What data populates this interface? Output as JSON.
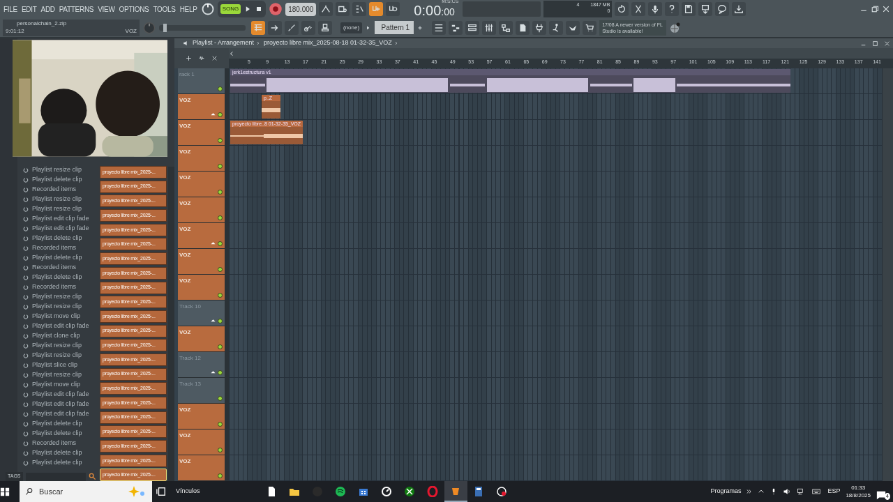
{
  "menu": [
    "FILE",
    "EDIT",
    "ADD",
    "PATTERNS",
    "VIEW",
    "OPTIONS",
    "TOOLS",
    "HELP"
  ],
  "transport": {
    "song_label": "SONG",
    "song_on": true,
    "tempo": "180.000"
  },
  "snap_tools": [
    {
      "on": false
    },
    {
      "on": false
    },
    {
      "on": false
    },
    {
      "on": true
    },
    {
      "on": false
    }
  ],
  "time": {
    "main": "0:00",
    "fraction": ":00",
    "label": "M:S:CS"
  },
  "monitor": {
    "cpu": "4",
    "memory": "1847 MB",
    "voices": "0"
  },
  "hint": {
    "title": "personalchain_2.zip",
    "value": "9:01:12",
    "channel": "VOZ"
  },
  "master_pitch": {
    "level": 0.05
  },
  "view_tools": [
    {
      "on": true
    },
    {
      "on": false
    },
    {
      "on": false
    },
    {
      "on": false
    },
    {
      "on": false
    }
  ],
  "pattern": {
    "none": "(none)",
    "name": "Pattern 1"
  },
  "news": {
    "date": "17/08",
    "text": "A newer version of FL Studio is available!"
  },
  "history": [
    {
      "label": "Playlist resize clip"
    },
    {
      "label": "Playlist delete clip"
    },
    {
      "label": "Recorded items"
    },
    {
      "label": "Playlist resize clip"
    },
    {
      "label": "Playlist resize clip"
    },
    {
      "label": "Playlist edit clip fade"
    },
    {
      "label": "Playlist edit clip fade"
    },
    {
      "label": "Playlist delete clip"
    },
    {
      "label": "Recorded items"
    },
    {
      "label": "Playlist delete clip"
    },
    {
      "label": "Recorded items"
    },
    {
      "label": "Playlist delete clip"
    },
    {
      "label": "Recorded items"
    },
    {
      "label": "Playlist resize clip"
    },
    {
      "label": "Playlist resize clip"
    },
    {
      "label": "Playlist move clip"
    },
    {
      "label": "Playlist edit clip fade"
    },
    {
      "label": "Playlist clone clip"
    },
    {
      "label": "Playlist resize clip"
    },
    {
      "label": "Playlist resize clip"
    },
    {
      "label": "Playlist slice clip"
    },
    {
      "label": "Playlist resize clip"
    },
    {
      "label": "Playlist move clip"
    },
    {
      "label": "Playlist edit clip fade"
    },
    {
      "label": "Playlist edit clip fade"
    },
    {
      "label": "Playlist edit clip fade"
    },
    {
      "label": "Playlist delete clip"
    },
    {
      "label": "Playlist delete clip"
    },
    {
      "label": "Recorded items"
    },
    {
      "label": "Playlist delete clip"
    },
    {
      "label": "Playlist delete clip"
    }
  ],
  "clips_list": [
    {
      "label": "proyecto libre mix_2025-...",
      "selected": false
    },
    {
      "label": "proyecto libre mix_2025-...",
      "selected": false
    },
    {
      "label": "proyecto libre mix_2025-...",
      "selected": false
    },
    {
      "label": "proyecto libre mix_2025-...",
      "selected": false
    },
    {
      "label": "proyecto libre mix_2025-...",
      "selected": false
    },
    {
      "label": "proyecto libre mix_2025-...",
      "selected": false
    },
    {
      "label": "proyecto libre mix_2025-...",
      "selected": false
    },
    {
      "label": "proyecto libre mix_2025-...",
      "selected": false
    },
    {
      "label": "proyecto libre mix_2025-...",
      "selected": false
    },
    {
      "label": "proyecto libre mix_2025-...",
      "selected": false
    },
    {
      "label": "proyecto libre mix_2025-...",
      "selected": false
    },
    {
      "label": "proyecto libre mix_2025-...",
      "selected": false
    },
    {
      "label": "proyecto libre mix_2025-...",
      "selected": false
    },
    {
      "label": "proyecto libre mix_2025-...",
      "selected": false
    },
    {
      "label": "proyecto libre mix_2025-...",
      "selected": false
    },
    {
      "label": "proyecto libre mix_2025-...",
      "selected": false
    },
    {
      "label": "proyecto libre mix_2025-...",
      "selected": false
    },
    {
      "label": "proyecto libre mix_2025-...",
      "selected": false
    },
    {
      "label": "proyecto libre mix_2025-...",
      "selected": false
    },
    {
      "label": "proyecto libre mix_2025-...",
      "selected": false
    },
    {
      "label": "proyecto libre mix_2025-...",
      "selected": false
    },
    {
      "label": "proyecto libre mix_2025-...",
      "selected": true
    }
  ],
  "tags": {
    "label": "TAGS"
  },
  "playlist": {
    "title": "Playlist - Arrangement",
    "pattern": "proyecto libre mix_2025-08-18 01-32-35_VOZ",
    "ruler": [
      "5",
      "9",
      "13",
      "17",
      "21",
      "25",
      "29",
      "33",
      "37",
      "41",
      "45",
      "49",
      "53",
      "57",
      "61",
      "65",
      "69",
      "73",
      "77",
      "81",
      "85",
      "89",
      "93",
      "97",
      "101",
      "105",
      "109",
      "113",
      "117",
      "121",
      "125",
      "129",
      "133",
      "137",
      "141"
    ],
    "tracks": [
      {
        "name": "rack 1",
        "color": "#4e5a62",
        "up_arrow": false,
        "clips": [
          {
            "label": "jerk1estructura v1",
            "kind": "long"
          }
        ]
      },
      {
        "name": "VOZ",
        "color": "#b86b3e",
        "up_arrow": true,
        "clips": [
          {
            "label": "p..Z",
            "kind": "short"
          }
        ]
      },
      {
        "name": "VOZ",
        "color": "#b86b3e",
        "up_arrow": false,
        "clips": [
          {
            "label": "proyecto libre..8 01-32-35_VOZ",
            "kind": "take"
          }
        ]
      },
      {
        "name": "VOZ",
        "color": "#b86b3e",
        "up_arrow": false
      },
      {
        "name": "VOZ",
        "color": "#b86b3e",
        "up_arrow": false
      },
      {
        "name": "VOZ",
        "color": "#b86b3e",
        "up_arrow": false
      },
      {
        "name": "VOZ",
        "color": "#b86b3e",
        "up_arrow": true
      },
      {
        "name": "VOZ",
        "color": "#b86b3e",
        "up_arrow": false
      },
      {
        "name": "VOZ",
        "color": "#b86b3e",
        "up_arrow": false
      },
      {
        "name": "Track 10",
        "color": "#4e5a62",
        "up_arrow": true
      },
      {
        "name": "VOZ",
        "color": "#b86b3e",
        "up_arrow": false
      },
      {
        "name": "Track 12",
        "color": "#4e5a62",
        "up_arrow": true
      },
      {
        "name": "Track 13",
        "color": "#4e5a62",
        "up_arrow": false
      },
      {
        "name": "VOZ",
        "color": "#b86b3e",
        "up_arrow": false
      },
      {
        "name": "VOZ",
        "color": "#b86b3e",
        "up_arrow": false
      },
      {
        "name": "VOZ",
        "color": "#b86b3e",
        "up_arrow": false
      }
    ]
  },
  "taskbar": {
    "search": "Buscar",
    "links": "Vínculos",
    "tray_label": "Programas",
    "language": "ESP",
    "time": "01:33",
    "date": "18/8/2025",
    "notifications": "4"
  }
}
